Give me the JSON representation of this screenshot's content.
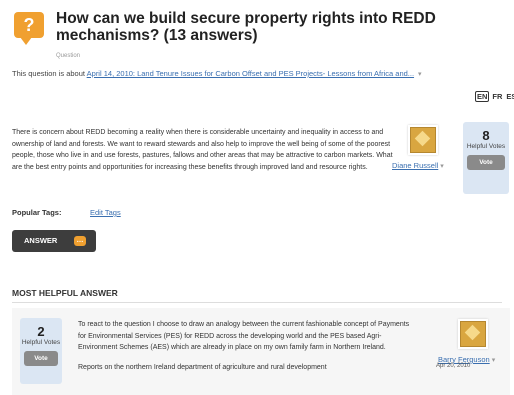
{
  "question": {
    "title": "How can we build secure property rights into REDD mechanisms? (13 answers)",
    "type_label": "Question",
    "about_prefix": "This question is about",
    "about_link": "April 14, 2010: Land Tenure Issues for Carbon Offset and PES Projects- Lessons from Africa and...",
    "body": "There is concern about REDD becoming a reality when there is considerable uncertainty and inequality in access to and ownership of land and forests. We want to reward stewards and also help to improve the well being of some of the poorest people, those who live in and use forests, pastures, fallows and other areas that may be attractive to carbon markets. What are the best entry points and opportunities for increasing these benefits through improved land and resource rights.",
    "author": "Diane Russell",
    "votes": "8",
    "votes_label": "Helpful Votes",
    "vote_button": "Vote"
  },
  "languages": [
    "EN",
    "FR",
    "ES"
  ],
  "tags": {
    "label": "Popular Tags:",
    "edit_label": "Edit Tags"
  },
  "answer_button": "ANSWER",
  "most_helpful": {
    "heading": "MOST HELPFUL ANSWER",
    "votes": "2",
    "votes_label": "Helpful Votes",
    "vote_button": "Vote",
    "text_p1": "To react to the question I choose to draw an analogy between the current fashionable concept of Payments for Environmental Services (PES) for REDD across the developing world and the PES based Agri-Environment Schemes (AES) which are already in place on my own family farm in Northern Ireland.",
    "text_p2": "Reports on the northern Ireland department of agriculture and rural development",
    "author": "Barry Ferguson",
    "date": "Apr 20, 2010"
  },
  "colors": {
    "accent_orange": "#f0a030",
    "link_blue": "#3a6fb0",
    "vote_box_bg": "#dbe6f3"
  }
}
